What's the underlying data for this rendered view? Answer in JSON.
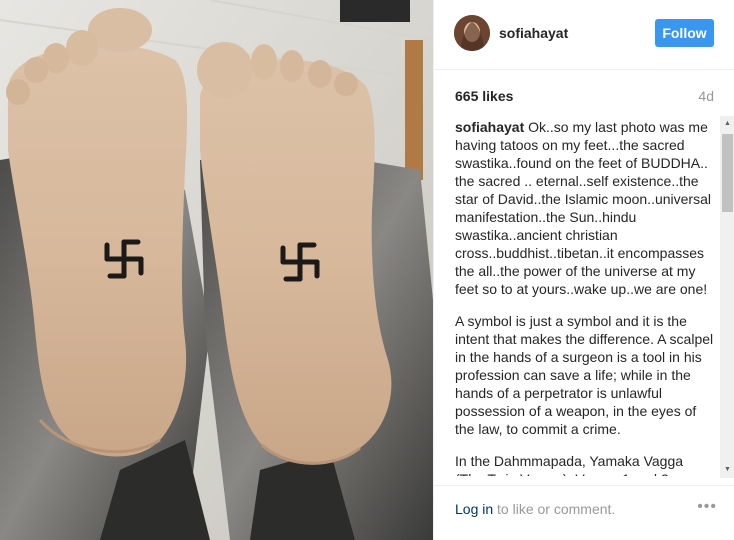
{
  "post": {
    "username": "sofiahayat",
    "follow_label": "Follow",
    "likes": "665 likes",
    "time_ago": "4d"
  },
  "caption": {
    "author": "sofiahayat",
    "paragraphs": [
      "Ok..so my last photo was me having tatoos on my feet...the sacred swastika..found on the feet of BUDDHA.. the sacred .. eternal..self existence..the star of David..the Islamic moon..universal manifestation..the Sun..hindu swastika..ancient christian cross..buddhist..tibetan..it encompasses the all..the power of the universe at my feet so to at yours..wake up..we are one!",
      "A symbol is just a symbol and it is the intent that makes the difference. A scalpel in the hands of a surgeon is a tool in his profession can save a life; while in the hands of a perpetrator is unlawful possession of a weapon, in the eyes of the law, to commit a crime.",
      "In the Dahmmapada, Yamaka Vagga (The Twin Verses), Verses 1 and 2 straighten our minds and views on good and evil intentions. “Menopubba “m anggi"
    ]
  },
  "footer": {
    "login_link": "Log in",
    "login_rest": " to like or comment.",
    "more_label": "•••"
  },
  "scrollbar": {
    "up": "▲",
    "down": "▼"
  },
  "icons": {
    "avatar": "profile-photo",
    "more": "ellipsis-icon",
    "tattoo": "swastika-symbol"
  },
  "colors": {
    "follow_button": "#3897f0",
    "link": "#003569",
    "muted": "#999999",
    "text": "#262626"
  }
}
